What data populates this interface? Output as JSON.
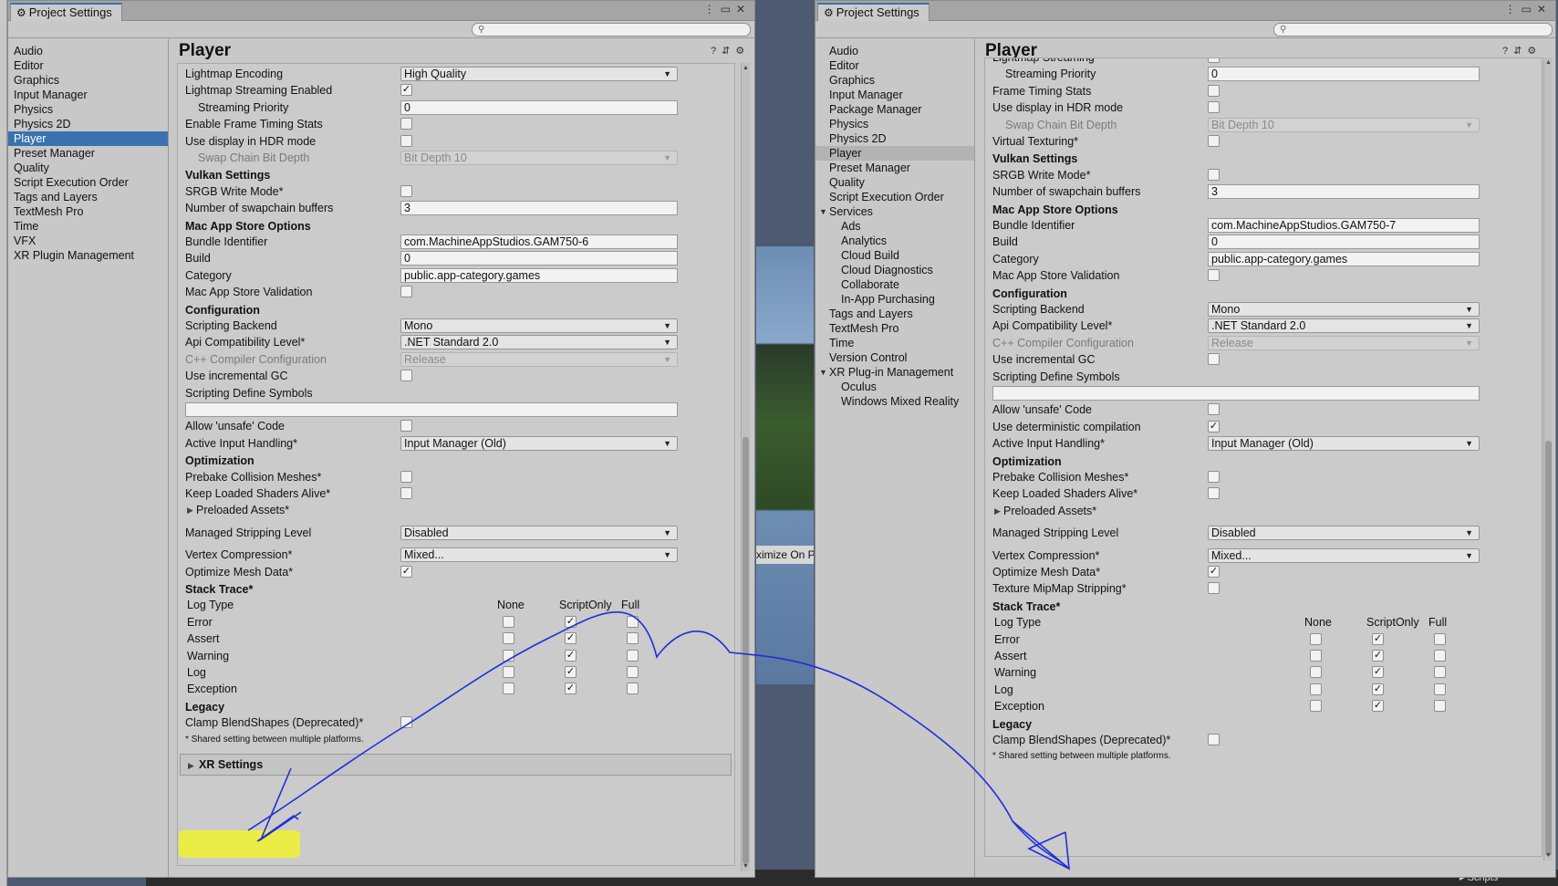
{
  "background": {
    "bar_text": "ximize On P",
    "scripts_label": "▸ Scripts"
  },
  "left_window": {
    "tab_title": "Project Settings",
    "page_title": "Player",
    "nav": [
      "Audio",
      "Editor",
      "Graphics",
      "Input Manager",
      "Physics",
      "Physics 2D",
      "Player",
      "Preset Manager",
      "Quality",
      "Script Execution Order",
      "Tags and Layers",
      "TextMesh Pro",
      "Time",
      "VFX",
      "XR Plugin Management"
    ],
    "selected": "Player",
    "rows": [
      {
        "type": "dropdown",
        "label": "Lightmap Encoding",
        "value": "High Quality"
      },
      {
        "type": "check",
        "label": "Lightmap Streaming Enabled",
        "checked": true
      },
      {
        "type": "field",
        "label": "Streaming Priority",
        "value": "0",
        "indent": true
      },
      {
        "type": "check",
        "label": "Enable Frame Timing Stats",
        "checked": false
      },
      {
        "type": "check",
        "label": "Use display in HDR mode",
        "checked": false
      },
      {
        "type": "dropdown",
        "label": "Swap Chain Bit Depth",
        "value": "Bit Depth 10",
        "disabled": true,
        "indent": true
      },
      {
        "type": "header",
        "label": "Vulkan Settings"
      },
      {
        "type": "check",
        "label": "SRGB Write Mode*",
        "checked": false
      },
      {
        "type": "field",
        "label": "Number of swapchain buffers",
        "value": "3"
      },
      {
        "type": "header",
        "label": "Mac App Store Options"
      },
      {
        "type": "field",
        "label": "Bundle Identifier",
        "value": "com.MachineAppStudios.GAM750-6"
      },
      {
        "type": "field",
        "label": "Build",
        "value": "0"
      },
      {
        "type": "field",
        "label": "Category",
        "value": "public.app-category.games"
      },
      {
        "type": "check",
        "label": "Mac App Store Validation",
        "checked": false
      },
      {
        "type": "header",
        "label": "Configuration"
      },
      {
        "type": "dropdown",
        "label": "Scripting Backend",
        "value": "Mono"
      },
      {
        "type": "dropdown",
        "label": "Api Compatibility Level*",
        "value": ".NET Standard 2.0"
      },
      {
        "type": "dropdown",
        "label": "C++ Compiler Configuration",
        "value": "Release",
        "disabled": true
      },
      {
        "type": "check",
        "label": "Use incremental GC",
        "checked": false
      },
      {
        "type": "label",
        "label": "Scripting Define Symbols"
      },
      {
        "type": "widefield",
        "value": ""
      },
      {
        "type": "check",
        "label": "Allow 'unsafe' Code",
        "checked": false
      },
      {
        "type": "dropdown",
        "label": "Active Input Handling*",
        "value": "Input Manager (Old)"
      },
      {
        "type": "header",
        "label": "Optimization"
      },
      {
        "type": "check",
        "label": "Prebake Collision Meshes*",
        "checked": false
      },
      {
        "type": "check",
        "label": "Keep Loaded Shaders Alive*",
        "checked": false
      },
      {
        "type": "fold",
        "label": "Preloaded Assets*"
      },
      {
        "type": "dropdown",
        "label": "Managed Stripping Level",
        "value": "Disabled",
        "gap": true
      },
      {
        "type": "dropdown",
        "label": "Vertex Compression*",
        "value": "Mixed...",
        "gap": true
      },
      {
        "type": "check",
        "label": "Optimize Mesh Data*",
        "checked": true
      },
      {
        "type": "header",
        "label": "Stack Trace*"
      },
      {
        "type": "stackhdr",
        "label": "Log Type",
        "cols": [
          "None",
          "ScriptOnly",
          "Full"
        ]
      },
      {
        "type": "stack",
        "label": "Error",
        "checks": [
          false,
          true,
          false
        ]
      },
      {
        "type": "stack",
        "label": "Assert",
        "checks": [
          false,
          true,
          false
        ]
      },
      {
        "type": "stack",
        "label": "Warning",
        "checks": [
          false,
          true,
          false
        ]
      },
      {
        "type": "stack",
        "label": "Log",
        "checks": [
          false,
          true,
          false
        ]
      },
      {
        "type": "stack",
        "label": "Exception",
        "checks": [
          false,
          true,
          false
        ]
      },
      {
        "type": "header",
        "label": "Legacy"
      },
      {
        "type": "check",
        "label": "Clamp BlendShapes (Deprecated)*",
        "checked": false
      },
      {
        "type": "note",
        "label": "* Shared setting between multiple platforms."
      }
    ],
    "xr_settings_label": "XR Settings"
  },
  "right_window": {
    "tab_title": "Project Settings",
    "page_title": "Player",
    "nav": [
      {
        "label": "Audio",
        "level": 0
      },
      {
        "label": "Editor",
        "level": 0
      },
      {
        "label": "Graphics",
        "level": 0
      },
      {
        "label": "Input Manager",
        "level": 0
      },
      {
        "label": "Package Manager",
        "level": 0
      },
      {
        "label": "Physics",
        "level": 0
      },
      {
        "label": "Physics 2D",
        "level": 0
      },
      {
        "label": "Player",
        "level": 0,
        "selected": true
      },
      {
        "label": "Preset Manager",
        "level": 0
      },
      {
        "label": "Quality",
        "level": 0
      },
      {
        "label": "Script Execution Order",
        "level": 0
      },
      {
        "label": "Services",
        "level": 0,
        "expanded": true
      },
      {
        "label": "Ads",
        "level": 1
      },
      {
        "label": "Analytics",
        "level": 1
      },
      {
        "label": "Cloud Build",
        "level": 1
      },
      {
        "label": "Cloud Diagnostics",
        "level": 1
      },
      {
        "label": "Collaborate",
        "level": 1
      },
      {
        "label": "In-App Purchasing",
        "level": 1
      },
      {
        "label": "Tags and Layers",
        "level": 0
      },
      {
        "label": "TextMesh Pro",
        "level": 0
      },
      {
        "label": "Time",
        "level": 0
      },
      {
        "label": "Version Control",
        "level": 0
      },
      {
        "label": "XR Plug-in Management",
        "level": 0,
        "expanded": true
      },
      {
        "label": "Oculus",
        "level": 1
      },
      {
        "label": "Windows Mixed Reality",
        "level": 1
      }
    ],
    "rows": [
      {
        "type": "check",
        "label": "Lightmap Streaming",
        "checked": true
      },
      {
        "type": "field",
        "label": "Streaming Priority",
        "value": "0",
        "indent": true
      },
      {
        "type": "check",
        "label": "Frame Timing Stats",
        "checked": false
      },
      {
        "type": "check",
        "label": "Use display in HDR mode",
        "checked": false
      },
      {
        "type": "dropdown",
        "label": "Swap Chain Bit Depth",
        "value": "Bit Depth 10",
        "disabled": true,
        "indent": true
      },
      {
        "type": "check",
        "label": "Virtual Texturing*",
        "checked": false
      },
      {
        "type": "header",
        "label": "Vulkan Settings"
      },
      {
        "type": "check",
        "label": "SRGB Write Mode*",
        "checked": false
      },
      {
        "type": "field",
        "label": "Number of swapchain buffers",
        "value": "3"
      },
      {
        "type": "header",
        "label": "Mac App Store Options"
      },
      {
        "type": "field",
        "label": "Bundle Identifier",
        "value": "com.MachineAppStudios.GAM750-7"
      },
      {
        "type": "field",
        "label": "Build",
        "value": "0"
      },
      {
        "type": "field",
        "label": "Category",
        "value": "public.app-category.games"
      },
      {
        "type": "check",
        "label": "Mac App Store Validation",
        "checked": false
      },
      {
        "type": "header",
        "label": "Configuration"
      },
      {
        "type": "dropdown",
        "label": "Scripting Backend",
        "value": "Mono"
      },
      {
        "type": "dropdown",
        "label": "Api Compatibility Level*",
        "value": ".NET Standard 2.0"
      },
      {
        "type": "dropdown",
        "label": "C++ Compiler Configuration",
        "value": "Release",
        "disabled": true
      },
      {
        "type": "check",
        "label": "Use incremental GC",
        "checked": false
      },
      {
        "type": "label",
        "label": "Scripting Define Symbols"
      },
      {
        "type": "widefield",
        "value": ""
      },
      {
        "type": "check",
        "label": "Allow 'unsafe' Code",
        "checked": false
      },
      {
        "type": "check",
        "label": "Use deterministic compilation",
        "checked": true
      },
      {
        "type": "dropdown",
        "label": "Active Input Handling*",
        "value": "Input Manager (Old)"
      },
      {
        "type": "header",
        "label": "Optimization"
      },
      {
        "type": "check",
        "label": "Prebake Collision Meshes*",
        "checked": false
      },
      {
        "type": "check",
        "label": "Keep Loaded Shaders Alive*",
        "checked": false
      },
      {
        "type": "fold",
        "label": "Preloaded Assets*"
      },
      {
        "type": "dropdown",
        "label": "Managed Stripping Level",
        "value": "Disabled",
        "gap": true
      },
      {
        "type": "dropdown",
        "label": "Vertex Compression*",
        "value": "Mixed...",
        "gap": true
      },
      {
        "type": "check",
        "label": "Optimize Mesh Data*",
        "checked": true
      },
      {
        "type": "check",
        "label": "Texture MipMap Stripping*",
        "checked": false
      },
      {
        "type": "header",
        "label": "Stack Trace*"
      },
      {
        "type": "stackhdr",
        "label": "Log Type",
        "cols": [
          "None",
          "ScriptOnly",
          "Full"
        ]
      },
      {
        "type": "stack",
        "label": "Error",
        "checks": [
          false,
          true,
          false
        ]
      },
      {
        "type": "stack",
        "label": "Assert",
        "checks": [
          false,
          true,
          false
        ]
      },
      {
        "type": "stack",
        "label": "Warning",
        "checks": [
          false,
          true,
          false
        ]
      },
      {
        "type": "stack",
        "label": "Log",
        "checks": [
          false,
          true,
          false
        ]
      },
      {
        "type": "stack",
        "label": "Exception",
        "checks": [
          false,
          true,
          false
        ]
      },
      {
        "type": "header",
        "label": "Legacy"
      },
      {
        "type": "check",
        "label": "Clamp BlendShapes (Deprecated)*",
        "checked": false
      },
      {
        "type": "note",
        "label": "* Shared setting between multiple platforms."
      }
    ]
  },
  "annotation": {
    "ink_color": "#1f2fd8",
    "highlight_color": "#f2f230"
  }
}
